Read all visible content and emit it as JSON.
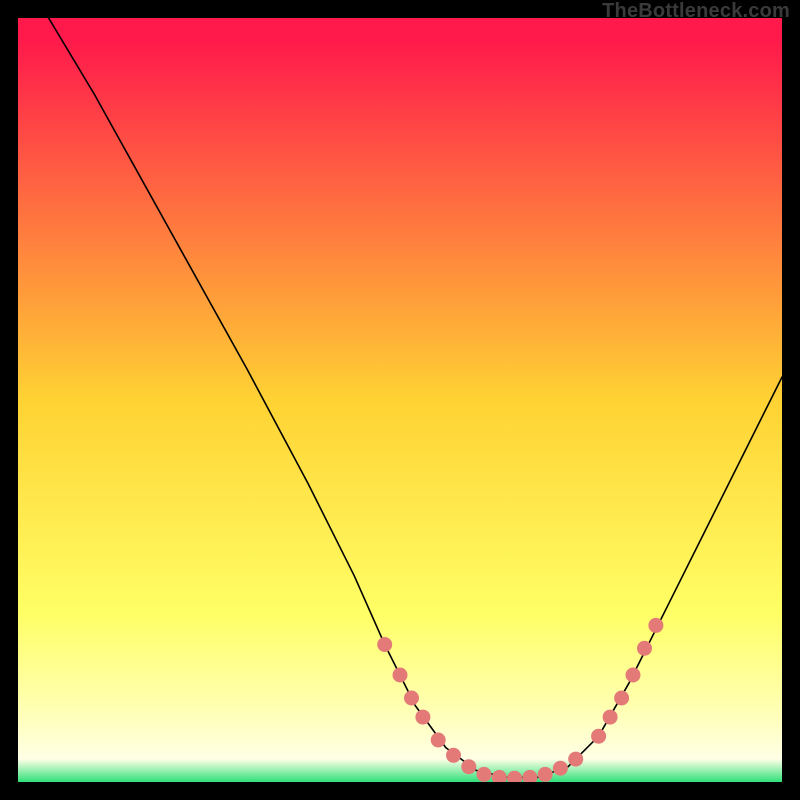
{
  "watermark": "TheBottleneck.com",
  "chart_data": {
    "type": "line",
    "title": "",
    "xlabel": "",
    "ylabel": "",
    "xlim": [
      0,
      100
    ],
    "ylim": [
      0,
      100
    ],
    "background_gradient": {
      "stops": [
        {
          "offset": 0.0,
          "color": "#ff1a4b"
        },
        {
          "offset": 0.03,
          "color": "#ff1a4b"
        },
        {
          "offset": 0.5,
          "color": "#ffd233"
        },
        {
          "offset": 0.78,
          "color": "#ffff66"
        },
        {
          "offset": 0.9,
          "color": "#ffffb0"
        },
        {
          "offset": 0.97,
          "color": "#ffffe6"
        },
        {
          "offset": 1.0,
          "color": "#2fe07a"
        }
      ]
    },
    "series": [
      {
        "name": "curve",
        "color": "#000000",
        "width": 1.6,
        "points": [
          {
            "x": 4.0,
            "y": 100.0
          },
          {
            "x": 10.0,
            "y": 90.0
          },
          {
            "x": 20.0,
            "y": 72.0
          },
          {
            "x": 30.0,
            "y": 54.0
          },
          {
            "x": 38.0,
            "y": 39.0
          },
          {
            "x": 44.0,
            "y": 27.0
          },
          {
            "x": 48.0,
            "y": 18.0
          },
          {
            "x": 52.0,
            "y": 10.0
          },
          {
            "x": 56.0,
            "y": 4.5
          },
          {
            "x": 60.0,
            "y": 1.5
          },
          {
            "x": 64.0,
            "y": 0.6
          },
          {
            "x": 68.0,
            "y": 0.6
          },
          {
            "x": 72.0,
            "y": 2.0
          },
          {
            "x": 76.0,
            "y": 6.0
          },
          {
            "x": 80.0,
            "y": 13.0
          },
          {
            "x": 85.0,
            "y": 23.0
          },
          {
            "x": 90.0,
            "y": 33.0
          },
          {
            "x": 95.0,
            "y": 43.0
          },
          {
            "x": 100.0,
            "y": 53.0
          }
        ]
      }
    ],
    "markers": {
      "color": "#e47a78",
      "radius": 7.5,
      "points": [
        {
          "x": 48.0,
          "y": 18.0
        },
        {
          "x": 50.0,
          "y": 14.0
        },
        {
          "x": 51.5,
          "y": 11.0
        },
        {
          "x": 53.0,
          "y": 8.5
        },
        {
          "x": 55.0,
          "y": 5.5
        },
        {
          "x": 57.0,
          "y": 3.5
        },
        {
          "x": 59.0,
          "y": 2.0
        },
        {
          "x": 61.0,
          "y": 1.0
        },
        {
          "x": 63.0,
          "y": 0.6
        },
        {
          "x": 65.0,
          "y": 0.5
        },
        {
          "x": 67.0,
          "y": 0.6
        },
        {
          "x": 69.0,
          "y": 1.0
        },
        {
          "x": 71.0,
          "y": 1.8
        },
        {
          "x": 73.0,
          "y": 3.0
        },
        {
          "x": 76.0,
          "y": 6.0
        },
        {
          "x": 77.5,
          "y": 8.5
        },
        {
          "x": 79.0,
          "y": 11.0
        },
        {
          "x": 80.5,
          "y": 14.0
        },
        {
          "x": 82.0,
          "y": 17.5
        },
        {
          "x": 83.5,
          "y": 20.5
        }
      ]
    }
  }
}
